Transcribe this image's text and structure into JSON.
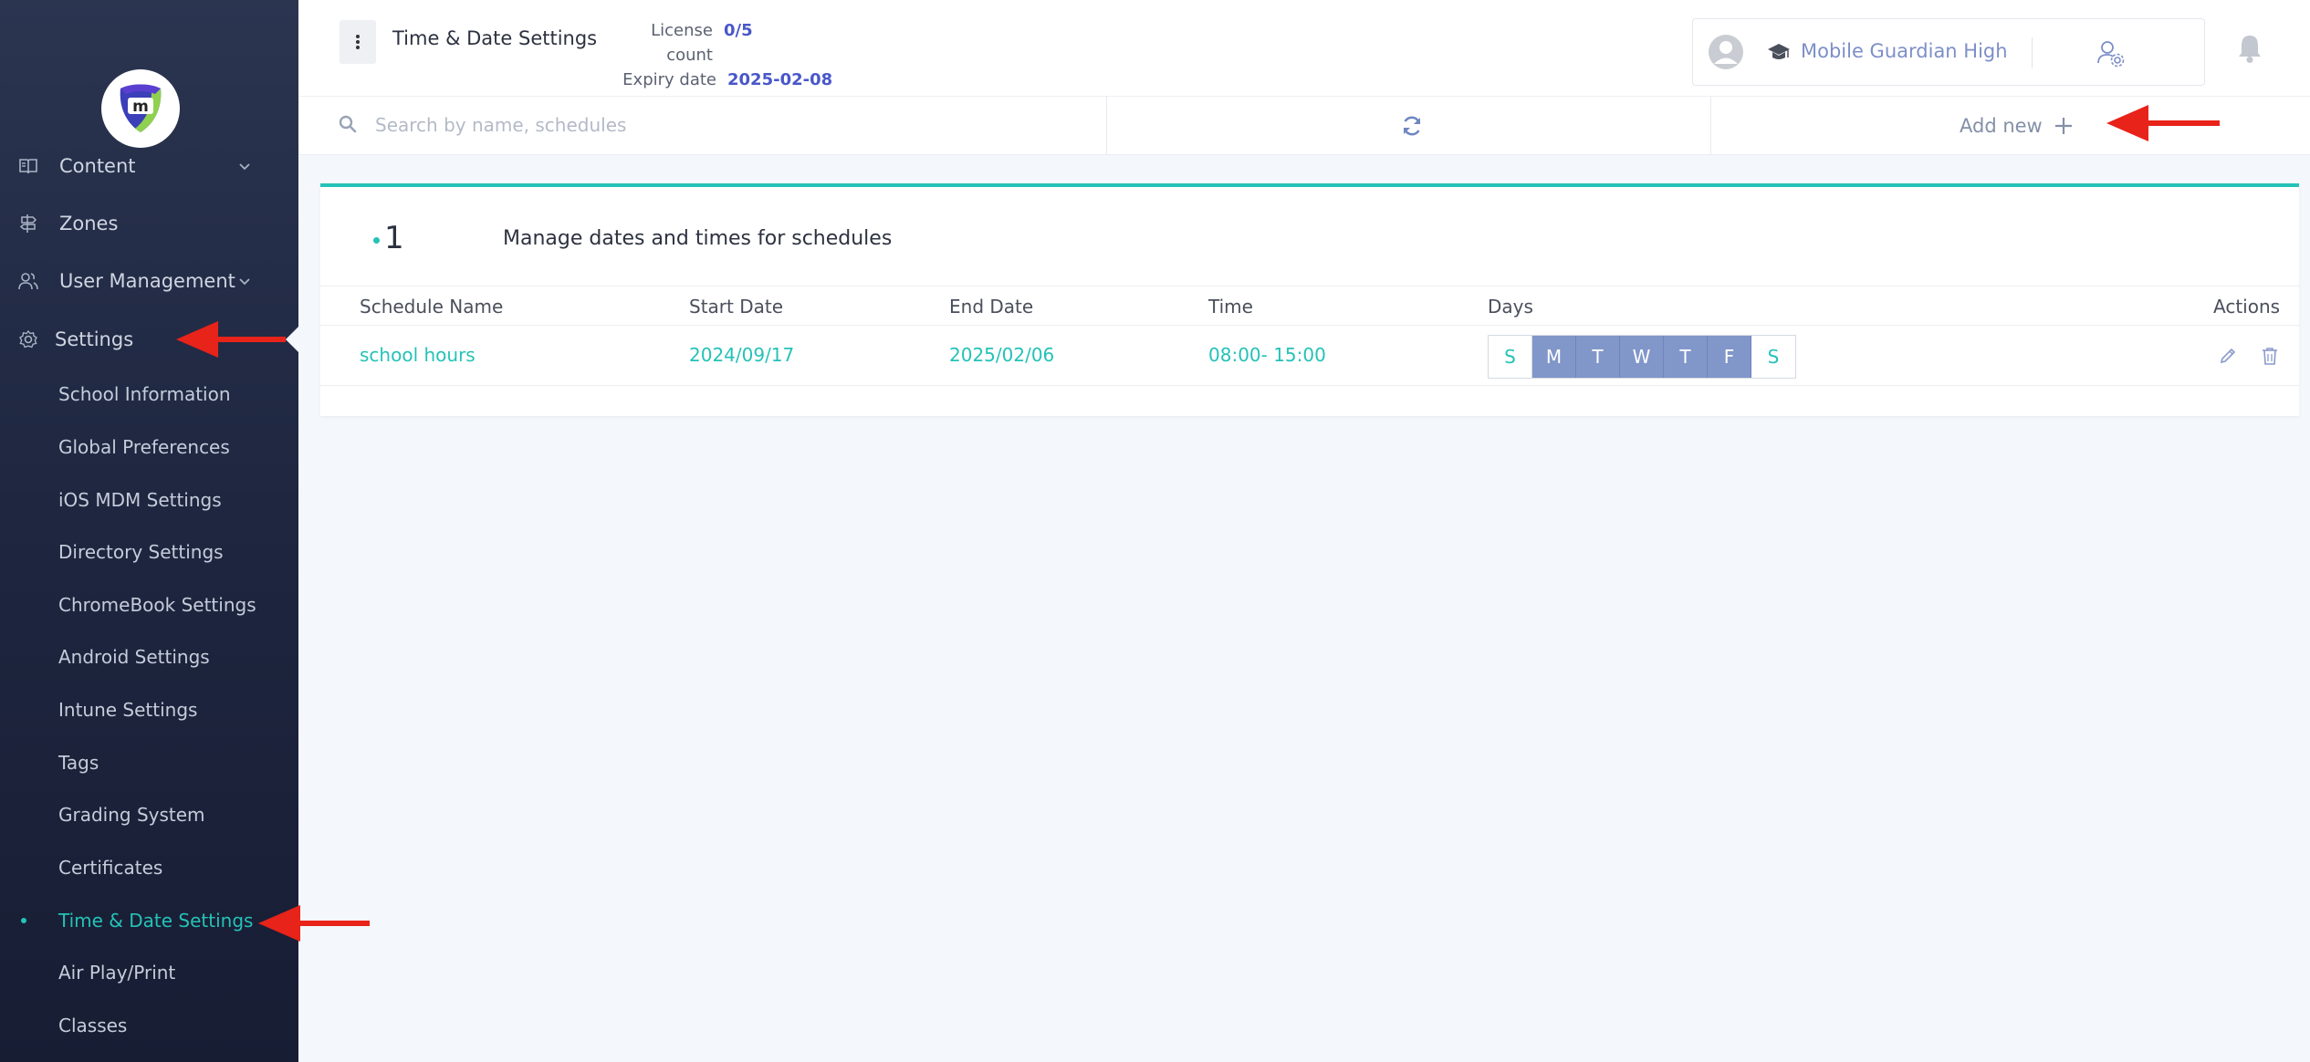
{
  "sidebar": {
    "top_items": [
      {
        "label": "Content",
        "icon": "book-icon",
        "has_chevron": true
      },
      {
        "label": "Zones",
        "icon": "signpost-icon",
        "has_chevron": false
      },
      {
        "label": "User Management",
        "icon": "users-icon",
        "has_chevron": true
      },
      {
        "label": "Settings",
        "icon": "gear-icon",
        "has_chevron": false
      }
    ],
    "settings_items": [
      "School Information",
      "Global Preferences",
      "iOS MDM Settings",
      "Directory Settings",
      "ChromeBook Settings",
      "Android Settings",
      "Intune Settings",
      "Tags",
      "Grading System",
      "Certificates",
      "Time & Date Settings",
      "Air Play/Print",
      "Classes"
    ],
    "active_item": "Time & Date Settings"
  },
  "header": {
    "title": "Time & Date Settings",
    "license_label": "License count",
    "license_value": "0/5",
    "expiry_label": "Expiry date",
    "expiry_value": "2025-02-08",
    "school_name": "Mobile Guardian High"
  },
  "toolbar": {
    "search_placeholder": "Search by name, schedules",
    "add_new_label": "Add new"
  },
  "card": {
    "count": "1",
    "description": "Manage dates and times for schedules",
    "columns": [
      "Schedule Name",
      "Start Date",
      "End Date",
      "Time",
      "Days",
      "Actions"
    ],
    "rows": [
      {
        "name": "school hours",
        "start": "2024/09/17",
        "end": "2025/02/06",
        "time": "08:00- 15:00",
        "days": [
          {
            "label": "S",
            "active": false
          },
          {
            "label": "M",
            "active": true
          },
          {
            "label": "T",
            "active": true
          },
          {
            "label": "W",
            "active": true
          },
          {
            "label": "T",
            "active": true
          },
          {
            "label": "F",
            "active": true
          },
          {
            "label": "S",
            "active": false
          }
        ]
      }
    ]
  },
  "colors": {
    "accent": "#25c2b7",
    "day_active": "#8196c9",
    "link_blue": "#4957c9",
    "annotation_red": "#e8231a"
  }
}
